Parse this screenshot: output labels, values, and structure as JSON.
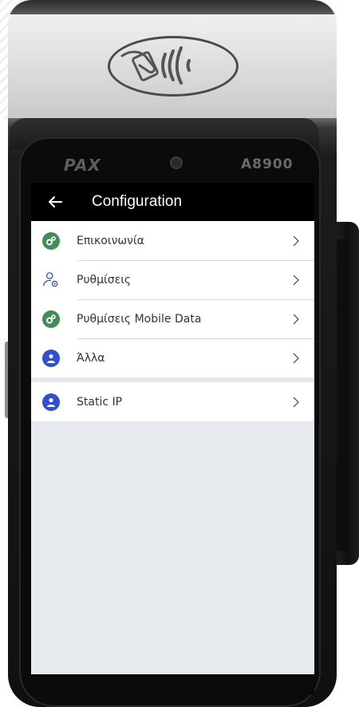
{
  "device": {
    "brand": "PAX",
    "model": "A8900"
  },
  "appbar": {
    "title": "Configuration",
    "back_icon": "back-arrow-icon"
  },
  "menu": {
    "items": [
      {
        "label": "Επικοινωνία",
        "icon": "gear-icon",
        "icon_color": "#3e8e55"
      },
      {
        "label": "Ρυθμίσεις",
        "icon": "user-settings-icon",
        "icon_color": "#2f4fd6"
      },
      {
        "label": "Ρυθμίσεις Mobile Data",
        "icon": "gear-icon",
        "icon_color": "#3e8e55"
      },
      {
        "label": "Άλλα",
        "icon": "user-icon",
        "icon_color": "#2f4fd6"
      },
      {
        "label": "Static IP",
        "icon": "user-icon",
        "icon_color": "#2f4fd6"
      }
    ]
  },
  "colors": {
    "appbar_bg": "#000000",
    "screen_bg": "#e6e9ee",
    "accent_green": "#3e8e55",
    "accent_blue": "#2f4fd6"
  }
}
